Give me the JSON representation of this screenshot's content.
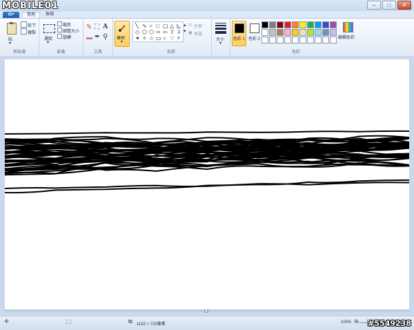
{
  "title_bar": {
    "logo_text": "MOBILE01",
    "buttons": [
      "minimize",
      "maximize",
      "close"
    ]
  },
  "tabs": {
    "app_menu_icon": "app-menu-icon",
    "items": [
      {
        "label": "常用",
        "active": true
      },
      {
        "label": "檢視",
        "active": false
      }
    ]
  },
  "ribbon": {
    "clipboard": {
      "group_label": "剪貼簿",
      "paste_label": "貼",
      "cut_label": "剪下",
      "copy_label": "複製"
    },
    "image": {
      "group_label": "影像",
      "select_label": "選取",
      "crop_label": "裁剪",
      "resize_label": "調整大小",
      "rotate_label": "旋轉"
    },
    "tools": {
      "group_label": "工具",
      "icons": [
        "pencil-icon",
        "fill-icon",
        "text-icon",
        "eraser-icon",
        "color-picker-icon",
        "magnifier-icon"
      ]
    },
    "brushes": {
      "label": "筆刷"
    },
    "shapes": {
      "group_label": "形狀",
      "outline_label": "外框",
      "fill_label": "填滿",
      "glyphs": [
        "╲",
        "∿",
        "○",
        "□",
        "▢",
        "△",
        "◺",
        "◇",
        "⬠",
        "⬡",
        "⇨",
        "⇦",
        "⇧",
        "⇩",
        "✦",
        "✧",
        "☆",
        "▭",
        "○",
        "♡",
        "⚡"
      ]
    },
    "size": {
      "label": "大小"
    },
    "colors": {
      "group_label": "色彩",
      "color1_label": "色彩 1",
      "color2_label": "色彩 2",
      "color1_value": "#000000",
      "color2_value": "#ffffff",
      "edit_label": "編輯色彩",
      "palette": [
        "#000000",
        "#7f7f7f",
        "#880015",
        "#ed1c24",
        "#ff7f27",
        "#fff200",
        "#22b14c",
        "#00a2e8",
        "#3f48cc",
        "#a349a4",
        "#ffffff",
        "#c3c3c3",
        "#b97a57",
        "#ffaec9",
        "#ffc90e",
        "#efe4b0",
        "#b5e61d",
        "#99d9ea",
        "#7092be",
        "#c8bfe7",
        "#ffffff",
        "#ffffff",
        "#ffffff",
        "#ffffff",
        "#ffffff",
        "#ffffff",
        "#ffffff",
        "#ffffff",
        "#ffffff",
        "#ffffff"
      ]
    }
  },
  "status_bar": {
    "dimensions": "1152 × 720像素",
    "zoom": "100%",
    "watermark": "#5549238"
  }
}
